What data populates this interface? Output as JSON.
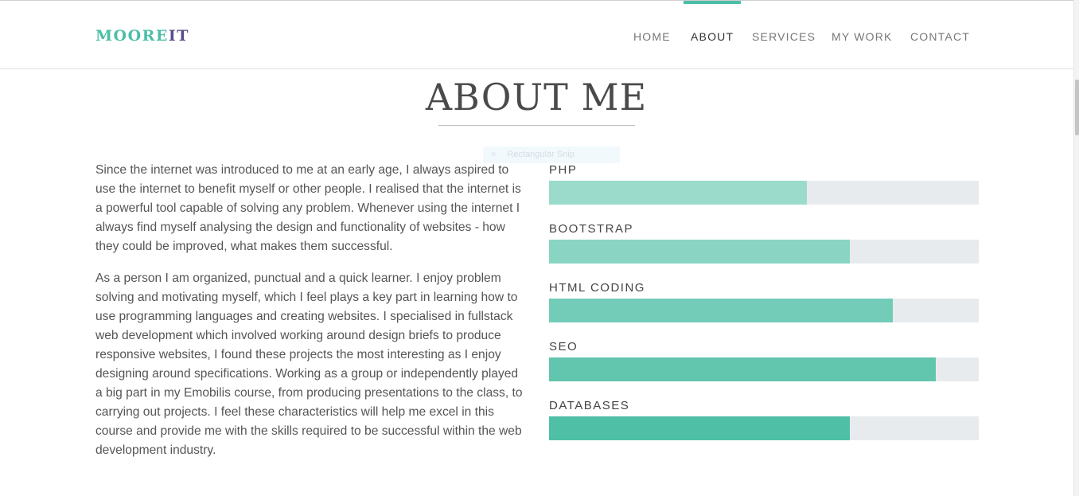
{
  "brand": {
    "part1": "MOORE",
    "part2": "IT"
  },
  "nav": {
    "items": [
      {
        "label": "HOME"
      },
      {
        "label": "ABOUT"
      },
      {
        "label": "SERVICES"
      },
      {
        "label": "MY WORK"
      },
      {
        "label": "CONTACT"
      }
    ],
    "active": "ABOUT"
  },
  "about": {
    "heading": "ABOUT ME",
    "paragraphs": [
      "Since the internet was introduced to me at an early age, I always aspired to use the internet to benefit myself or other people. I realised that the internet is a powerful tool capable of solving any problem. Whenever using the internet I always find myself analysing the design and functionality of websites - how they could be improved, what makes them successful.",
      "As a person I am organized, punctual and a quick learner. I enjoy problem solving and motivating myself, which I feel plays a key part in learning how to use programming languages and creating websites. I specialised in fullstack web development which involved working around design briefs to produce responsive websites, I found these projects the most interesting as I enjoy designing around specifications. Working as a group or independently played a big part in my Emobilis course, from producing presentations to the class, to carrying out projects. I feel these characteristics will help me excel in this course and provide me with the skills required to be successful within the web development industry."
    ]
  },
  "tooltip": {
    "icon": "×",
    "text": "Rectangular Snip"
  },
  "skills": [
    {
      "label": "PHP",
      "level": 0.6,
      "color": "#9adbcc"
    },
    {
      "label": "BOOTSTRAP",
      "level": 0.7,
      "color": "#89d4c2"
    },
    {
      "label": "HTML CODING",
      "level": 0.8,
      "color": "#72ccb8"
    },
    {
      "label": "SEO",
      "level": 0.9,
      "color": "#62c5ae"
    },
    {
      "label": "DATABASES",
      "level": 0.7,
      "color": "#4fbfa5"
    }
  ],
  "colors": {
    "accent": "#4bbfa6",
    "brand_secondary": "#5b4a8c",
    "track": "#e8ebed"
  }
}
